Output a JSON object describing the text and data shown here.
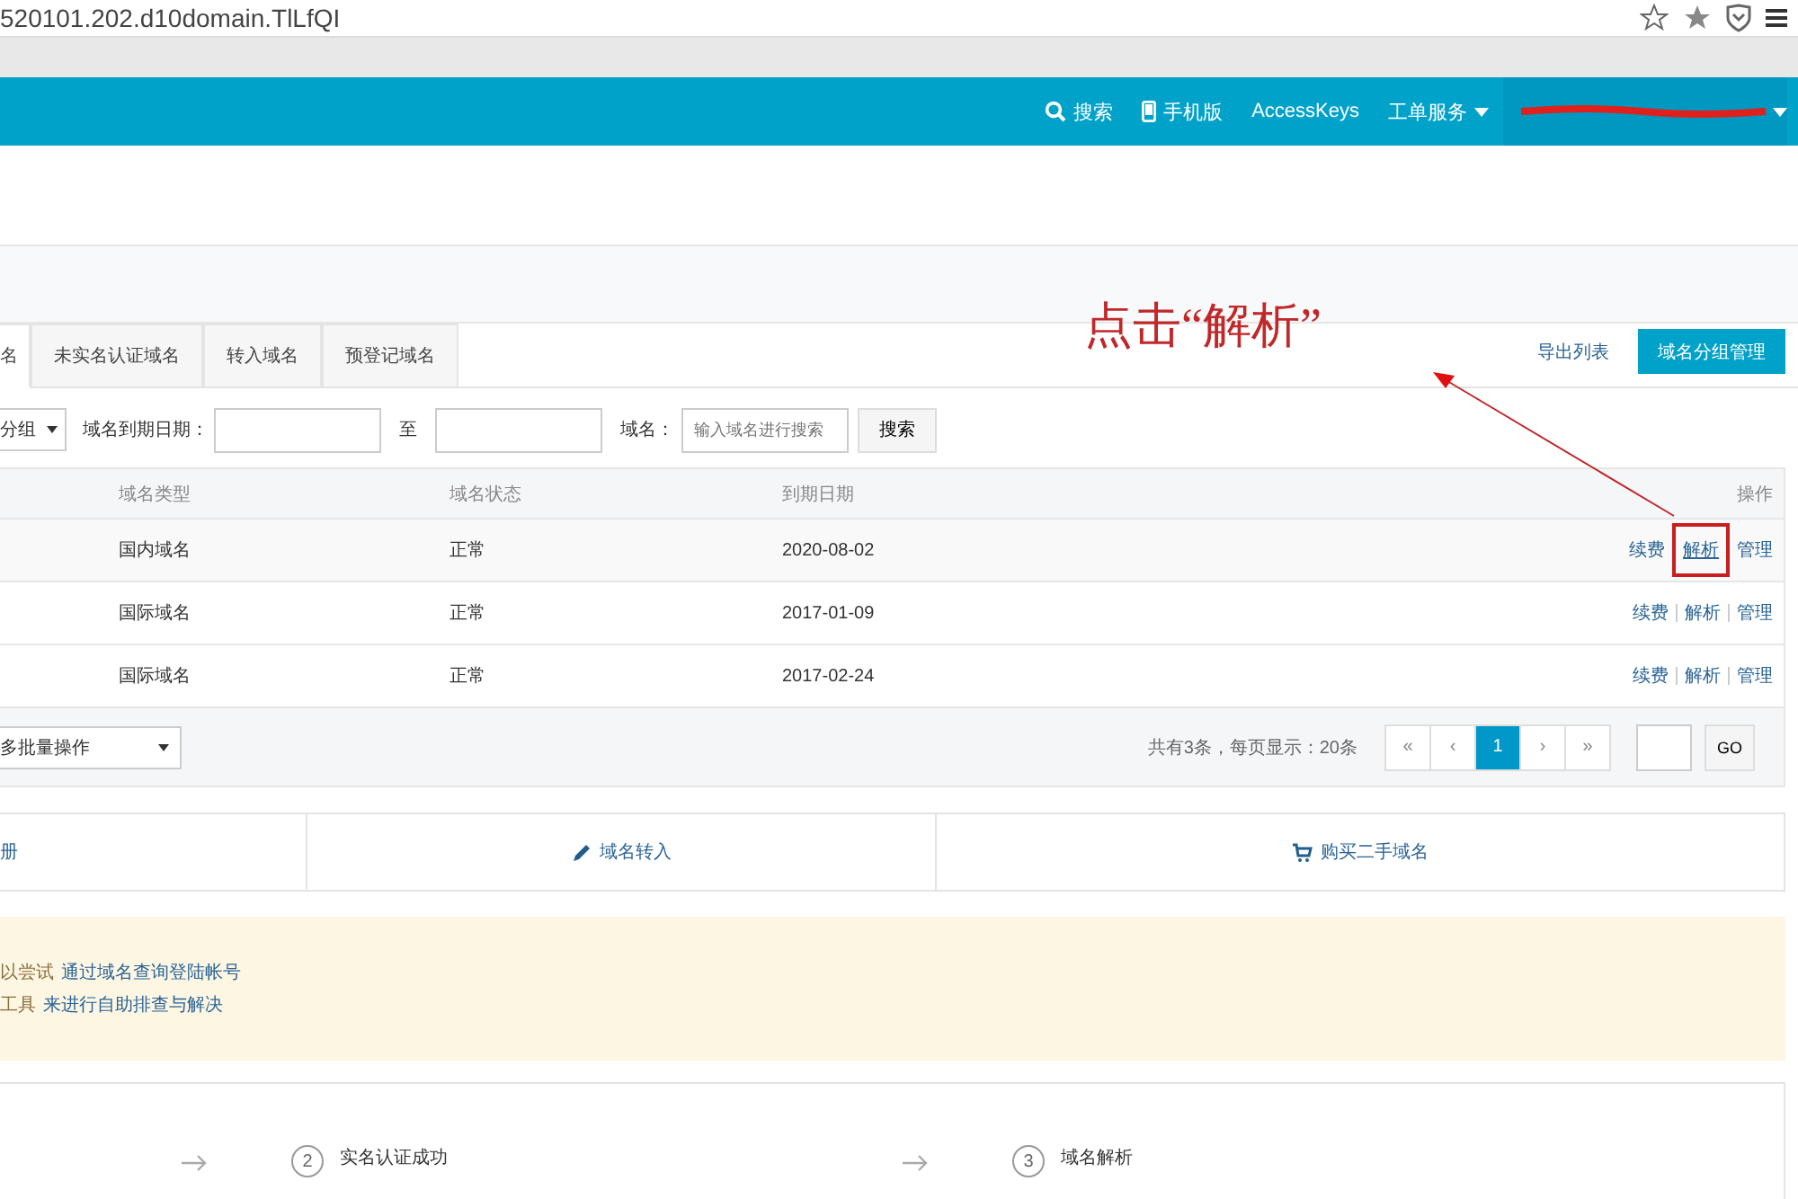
{
  "browser": {
    "url": "520101.202.d10domain.TlLfQI"
  },
  "topnav": {
    "items": [
      {
        "label": "搜索",
        "kind": "search"
      },
      {
        "label": "手机版",
        "kind": "phone"
      },
      {
        "label": "AccessKeys",
        "kind": "plain"
      },
      {
        "label": "工单服务",
        "kind": "dropdown"
      }
    ]
  },
  "tabs": [
    {
      "label": "名",
      "selected": true
    },
    {
      "label": "未实名认证域名",
      "selected": false
    },
    {
      "label": "转入域名",
      "selected": false
    },
    {
      "label": "预登记域名",
      "selected": false
    }
  ],
  "header_actions": {
    "export_link": "导出列表",
    "group_button": "域名分组管理"
  },
  "filters": {
    "group_select": "分组",
    "date_label": "域名到期日期：",
    "date_separator": "至",
    "domain_label": "域名：",
    "domain_placeholder": "输入域名进行搜索",
    "search_button": "搜索"
  },
  "table": {
    "columns": [
      "域名类型",
      "域名状态",
      "到期日期",
      "操作"
    ],
    "rows": [
      {
        "type": "国内域名",
        "status": "正常",
        "expiry": "2020-08-02",
        "actions": [
          {
            "label": "续费",
            "highlighted": false
          },
          {
            "label": "解析",
            "highlighted": true
          },
          {
            "label": "管理",
            "highlighted": false
          }
        ]
      },
      {
        "type": "国际域名",
        "status": "正常",
        "expiry": "2017-01-09",
        "actions": [
          {
            "label": "续费",
            "highlighted": false
          },
          {
            "label": "解析",
            "highlighted": false
          },
          {
            "label": "管理",
            "highlighted": false
          }
        ]
      },
      {
        "type": "国际域名",
        "status": "正常",
        "expiry": "2017-02-24",
        "actions": [
          {
            "label": "续费",
            "highlighted": false
          },
          {
            "label": "解析",
            "highlighted": false
          },
          {
            "label": "管理",
            "highlighted": false
          }
        ]
      }
    ]
  },
  "footer": {
    "bulk_select": "多批量操作",
    "summary": "共有3条，每页显示：20条",
    "pager": [
      {
        "label": "«",
        "selected": false
      },
      {
        "label": "‹",
        "selected": false
      },
      {
        "label": "1",
        "selected": true
      },
      {
        "label": "›",
        "selected": false
      },
      {
        "label": "»",
        "selected": false
      }
    ],
    "go_button": "GO"
  },
  "quick_actions": [
    {
      "label": "册",
      "kind": "plain"
    },
    {
      "label": "域名转入",
      "kind": "transfer"
    },
    {
      "label": "购买二手域名",
      "kind": "buy"
    }
  ],
  "notice": [
    {
      "text": "以尝试",
      "link": "通过域名查询登陆帐号"
    },
    {
      "text": "工具",
      "link": "来进行自助排查与解决"
    }
  ],
  "steps": [
    {
      "number": "2",
      "title": "实名认证成功"
    },
    {
      "number": "3",
      "title": "域名解析"
    }
  ],
  "annotation": {
    "text": "点击“解析”"
  }
}
